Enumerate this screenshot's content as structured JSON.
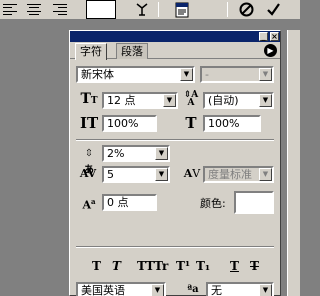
{
  "panel": {
    "tabs": [
      {
        "label": "字符"
      },
      {
        "label": "段落"
      }
    ],
    "font_family": "新宋体",
    "font_style": "-",
    "font_size": "12 点",
    "leading": "(自动)",
    "vertical_scale": "100%",
    "horizontal_scale": "100%",
    "baseline_percent": "2%",
    "tracking": "5",
    "kerning": "度量标准",
    "baseline_shift": "0 点",
    "color_label": "颜色:",
    "style_buttons": [
      "T",
      "T",
      "TT",
      "Tr",
      "T¹",
      "T₁",
      "T",
      "T"
    ],
    "language": "美国英语",
    "antialias_icon": "ªa",
    "antialias": "无"
  }
}
